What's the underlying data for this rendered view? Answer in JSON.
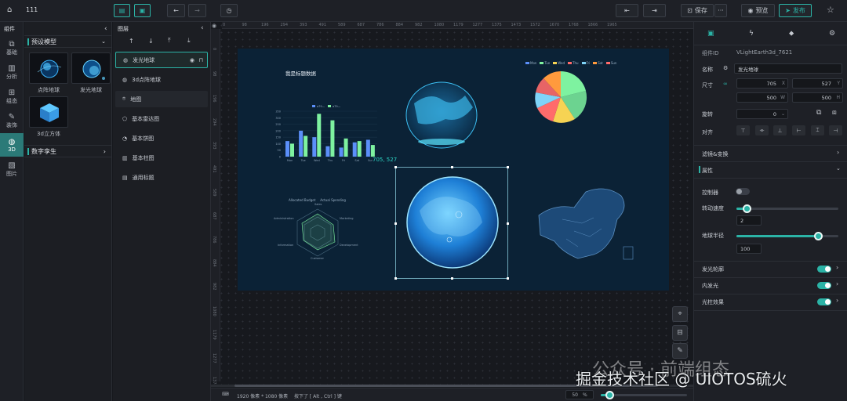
{
  "topbar": {
    "project_name": "111",
    "save_label": "保存",
    "preview_label": "预览",
    "publish_label": "发布"
  },
  "leftnav": {
    "title": "组件",
    "items": [
      "基础",
      "分析",
      "组态",
      "装饰",
      "3D",
      "图片"
    ]
  },
  "library": {
    "section_preset": "预设模型",
    "items": [
      "点阵地球",
      "发光地球",
      "3d立方体"
    ],
    "section_twin": "数字孪生"
  },
  "layers": {
    "title": "图层",
    "items": [
      "发光地球",
      "3d点阵地球",
      "地图",
      "基本雷达图",
      "基本饼图",
      "基本柱图",
      "通用标题"
    ]
  },
  "canvas": {
    "title": "我是标题数据",
    "bar_legend": [
      "a79—",
      "a79—"
    ],
    "bar_ticks_x": [
      "Mon",
      "Tue",
      "Wed",
      "Thu",
      "Fri",
      "Sat",
      "Sun"
    ],
    "bar_ticks_y": [
      "350",
      "300",
      "250",
      "200",
      "150",
      "100",
      "50",
      "0"
    ],
    "radar_legend": [
      "Allocated Budget",
      "Actual Spending"
    ],
    "radar_axes": [
      "Sales",
      "Marketing",
      "Development",
      "Customer",
      "Information",
      "Administration"
    ],
    "pie_legend": [
      "Mon",
      "Tue",
      "Wed",
      "Thu",
      "Fri",
      "Sat",
      "Sun"
    ],
    "pie_labels": [
      "Sun",
      "Sat",
      "Fri",
      "Thu",
      "Wed",
      "Tue",
      "Mon"
    ],
    "coord_label": "705, 527"
  },
  "ruler": {
    "h": [
      "0",
      "98",
      "196",
      "294",
      "393",
      "491",
      "589",
      "687",
      "786",
      "884",
      "982",
      "1080",
      "1179",
      "1277",
      "1375",
      "1473",
      "1572",
      "1670",
      "1768",
      "1866",
      "1965"
    ],
    "v": [
      "0",
      "98",
      "196",
      "294",
      "393",
      "491",
      "589",
      "687",
      "786",
      "884",
      "982",
      "1080",
      "1179",
      "1277",
      "1375"
    ]
  },
  "status": {
    "resolution": "1920 像素 * 1080 像素",
    "hint": "按下了 [ Alt , Ctrl ] 键",
    "zoom": "50",
    "zoom_unit": "%",
    "zoom_slider": 0.1
  },
  "props": {
    "tabs": [
      "layout-icon",
      "lightning-icon",
      "drop-icon",
      "settings-icon"
    ],
    "id_label": "组件ID",
    "id_value": "VLightEarth3d_7621",
    "name_label": "名称",
    "name_value": "发光地球",
    "size_label": "尺寸",
    "x": "705",
    "x_suffix": "X",
    "y": "527",
    "y_suffix": "Y",
    "w": "500",
    "w_suffix": "W",
    "h": "500",
    "h_suffix": "H",
    "rotate_label": "旋转",
    "rotate": "0",
    "align_label": "对齐",
    "filter_section": "滤镜&变换",
    "attr_section": "属性",
    "controller_label": "控制器",
    "speed_label": "转动速度",
    "speed_value": "2",
    "speed_slider": 0.1,
    "radius_label": "地球半径",
    "radius_value": "100",
    "radius_slider": 0.8,
    "glow_outline": "发光轮廓",
    "inner_glow": "内发光",
    "beam_effect": "光柱效果"
  },
  "watermark": {
    "line1": "公众号 · 前端组态",
    "line2": "掘金技术社区 @ UIOTOS硫火"
  },
  "colors": {
    "accent": "#2bb3a6",
    "canvas_bg": "#0b2236",
    "bar_a": "#5b8ff9",
    "bar_b": "#7ef2a0"
  },
  "chart_data": {
    "type": "bar",
    "categories": [
      "Mon",
      "Tue",
      "Wed",
      "Thu",
      "Fri",
      "Sat",
      "Sun"
    ],
    "series": [
      {
        "name": "a79—",
        "values": [
          120,
          200,
          150,
          80,
          70,
          110,
          130
        ]
      },
      {
        "name": "a79—",
        "values": [
          100,
          160,
          330,
          280,
          140,
          120,
          90
        ]
      }
    ],
    "ylim": [
      0,
      350
    ]
  }
}
